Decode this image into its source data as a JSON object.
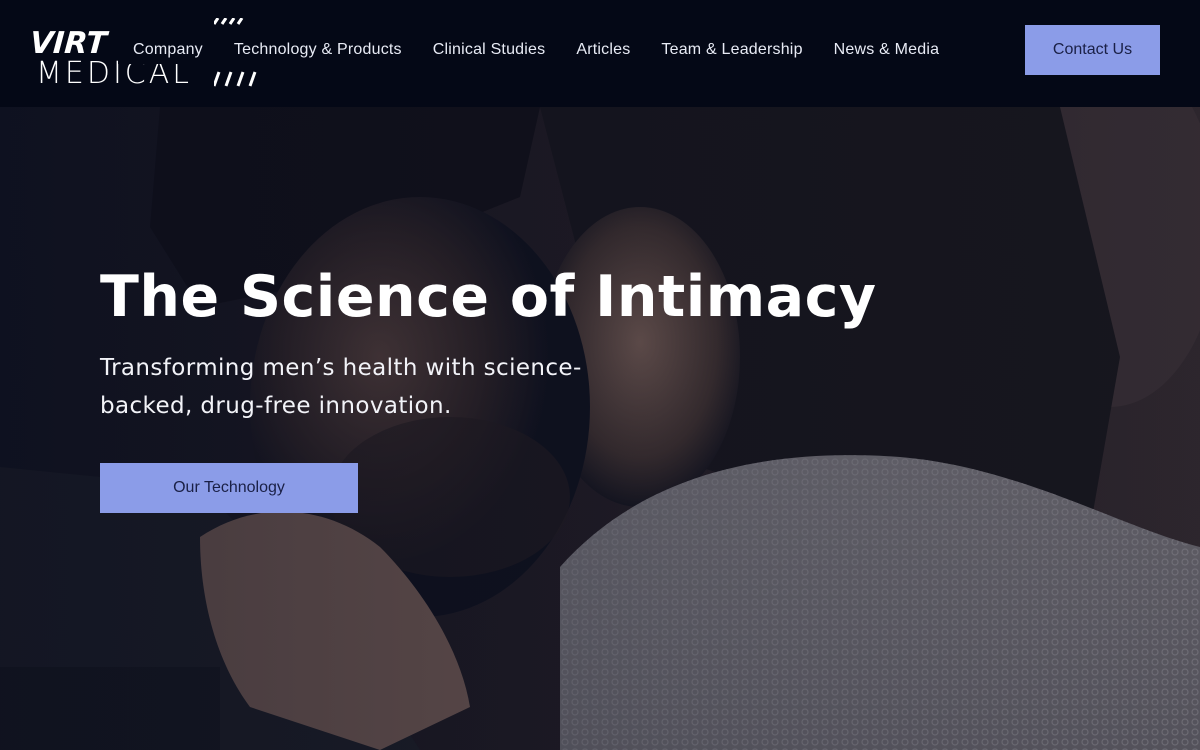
{
  "brand": {
    "logo_top": "VIRT",
    "logo_bottom": "MEDICAL"
  },
  "nav": {
    "items": [
      {
        "label": "Company"
      },
      {
        "label": "Technology & Products"
      },
      {
        "label": "Clinical Studies"
      },
      {
        "label": "Articles"
      },
      {
        "label": "Team & Leadership"
      },
      {
        "label": "News & Media"
      }
    ],
    "contact_label": "Contact Us"
  },
  "hero": {
    "title": "The Science of Intimacy",
    "subtitle": "Transforming men’s health with science-backed, drug-free innovation.",
    "cta_label": "Our Technology"
  },
  "colors": {
    "header_bg": "#040816",
    "accent": "#8b9ce8",
    "accent_text": "#1a2046"
  }
}
